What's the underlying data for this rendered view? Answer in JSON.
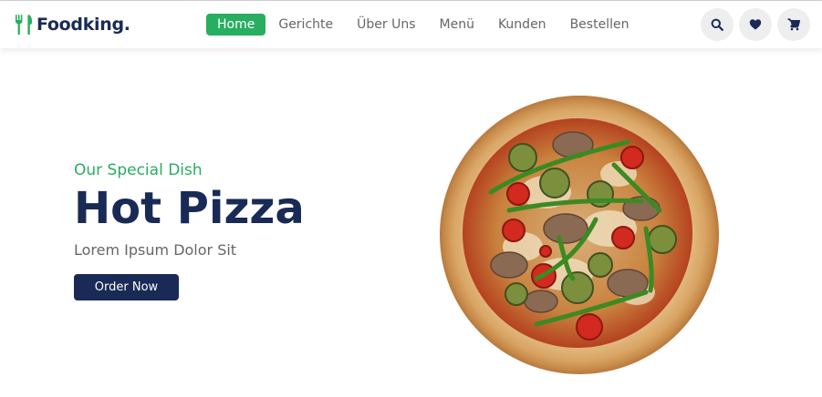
{
  "brand": {
    "name": "Foodking.",
    "icon": "utensils-icon",
    "accent": "#27ae60"
  },
  "nav": [
    {
      "label": "Home",
      "active": true
    },
    {
      "label": "Gerichte",
      "active": false
    },
    {
      "label": "Über Uns",
      "active": false
    },
    {
      "label": "Menü",
      "active": false
    },
    {
      "label": "Kunden",
      "active": false
    },
    {
      "label": "Bestellen",
      "active": false
    }
  ],
  "header_icons": [
    "search-icon",
    "heart-icon",
    "cart-icon"
  ],
  "hero": {
    "subtitle": "Our Special Dish",
    "title": "Hot Pizza",
    "description": "Lorem Ipsum Dolor Sit",
    "button_label": "Order Now",
    "image": "pizza-image"
  },
  "colors": {
    "primary": "#192a56",
    "green": "#27ae60",
    "text_muted": "#666666"
  }
}
